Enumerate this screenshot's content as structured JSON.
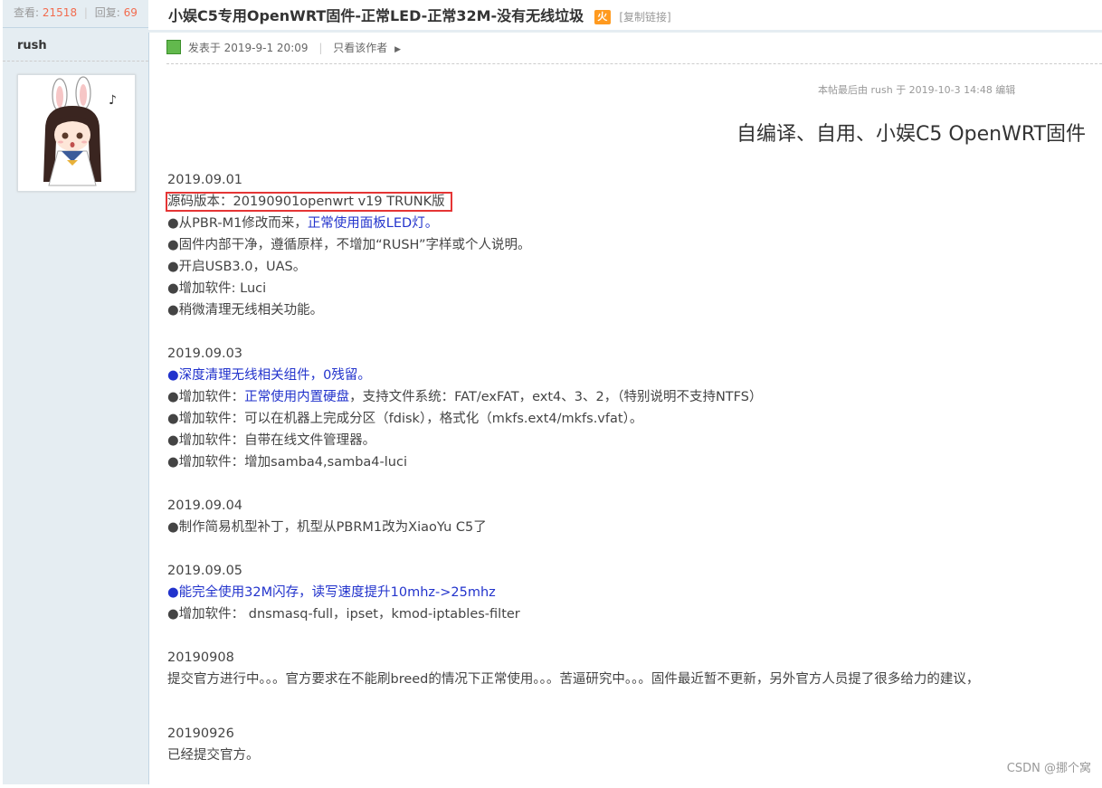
{
  "sidebar": {
    "views_label": "查看:",
    "views": "21518",
    "replies_label": "回复:",
    "replies": "69",
    "author": "rush"
  },
  "thread": {
    "title": "小娱C5专用OpenWRT固件-正常LED-正常32M-没有无线垃圾",
    "hot_icon": "火",
    "copy_link": "[复制链接]"
  },
  "post": {
    "posted": "发表于 2019-9-1 20:09",
    "only_author": "只看该作者",
    "edited_note": "本帖最后由 rush 于 2019-10-3 14:48 编辑",
    "heading": "自编译、自用、小娱C5 OpenWRT固件"
  },
  "content": {
    "b1": {
      "date": "2019.09.01",
      "source": "源码版本：20190901openwrt v19 TRUNK版",
      "l1a": "●从PBR-M1修改而来，",
      "l1b": "正常使用面板LED灯。",
      "l2": "●固件内部干净，遵循原样，不增加“RUSH”字样或个人说明。",
      "l3": "●开启USB3.0，UAS。",
      "l4": "●增加软件: Luci",
      "l5": "●稍微清理无线相关功能。"
    },
    "b2": {
      "date": "2019.09.03",
      "l1a": "●",
      "l1b": "深度清理无线相关组件，0残留。",
      "l2a": "●增加软件：",
      "l2b": "正常使用内置硬盘",
      "l2c": "，支持文件系统：FAT/exFAT，ext4、3、2，（特别说明不支持NTFS）",
      "l3": "●增加软件：可以在机器上完成分区（fdisk），格式化（mkfs.ext4/mkfs.vfat）。",
      "l4": "●增加软件：自带在线文件管理器。",
      "l5": "●增加软件：增加samba4,samba4-luci"
    },
    "b3": {
      "date": "2019.09.04",
      "l1": "●制作简易机型补丁，机型从PBRM1改为XiaoYu C5了"
    },
    "b4": {
      "date": "2019.09.05",
      "l1a": "●",
      "l1b": "能完全使用32M闪存，读写速度提升10mhz->25mhz",
      "l2": "●增加软件： dnsmasq-full，ipset，kmod-iptables-filter"
    },
    "b5": {
      "date": "20190908",
      "l1": "提交官方进行中。。。官方要求在不能刷breed的情况下正常使用。。。苦逼研究中。。。固件最近暂不更新，另外官方人员提了很多给力的建议，"
    },
    "b6": {
      "date": "20190926",
      "l1": "已经提交官方。"
    }
  },
  "watermark": "CSDN @挪个窝",
  "colors": {
    "sidebar_bg": "#e5edf2",
    "link_blue": "#2233cc",
    "highlight_box": "#e53535",
    "count_orange": "#f26c4f"
  }
}
